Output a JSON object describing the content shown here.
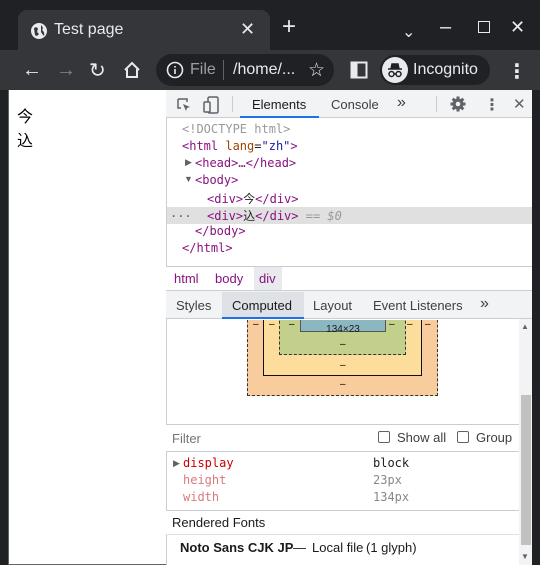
{
  "browser": {
    "tab_title": "Test page",
    "url_scheme_label": "File",
    "url_display": "/home/...",
    "incognito_label": "Incognito"
  },
  "page": {
    "lines": [
      "今",
      "込"
    ]
  },
  "devtools": {
    "tabs": [
      "Elements",
      "Console"
    ],
    "more_tabs": "»",
    "dom_lines": {
      "doctype": "<!DOCTYPE html>",
      "html_open_tag": "<html",
      "lang_attr": "lang",
      "lang_val": "\"zh\"",
      "head_collapsed": "<head>…</head>",
      "body_open": "<body>",
      "div1_open": "<div>",
      "div1_text": "今",
      "div1_close": "</div>",
      "div2_open": "<div>",
      "div2_text": "込",
      "div2_close": "</div>",
      "div2_eq": "== $0",
      "body_close": "</body>",
      "html_close": "</html>",
      "ellipsis": "..."
    },
    "breadcrumbs": [
      "html",
      "body",
      "div"
    ],
    "subtabs": [
      "Styles",
      "Computed",
      "Layout",
      "Event Listeners"
    ],
    "subtab_more": "»",
    "box_model": {
      "content_size": "134×23",
      "dash": "–"
    },
    "filter": {
      "placeholder": "Filter",
      "show_all": "Show all",
      "group": "Group"
    },
    "computed_props": [
      {
        "name": "display",
        "value": "block",
        "expandable": true
      },
      {
        "name": "height",
        "value": "23px",
        "expandable": false
      },
      {
        "name": "width",
        "value": "134px",
        "expandable": false
      }
    ],
    "rendered_fonts": {
      "title": "Rendered Fonts",
      "font_name": "Noto Sans CJK JP",
      "separator": "—",
      "source": "Local file",
      "glyphs": "(1 glyph)"
    }
  },
  "colors": {
    "chrome_dark": "#202124",
    "toolbar": "#35363a",
    "accent": "#1a73e8",
    "margin_box": "#f9cc9d",
    "border_box": "#fddd9b",
    "padding_box": "#c3d08b",
    "content_box": "#8cb6c0"
  }
}
